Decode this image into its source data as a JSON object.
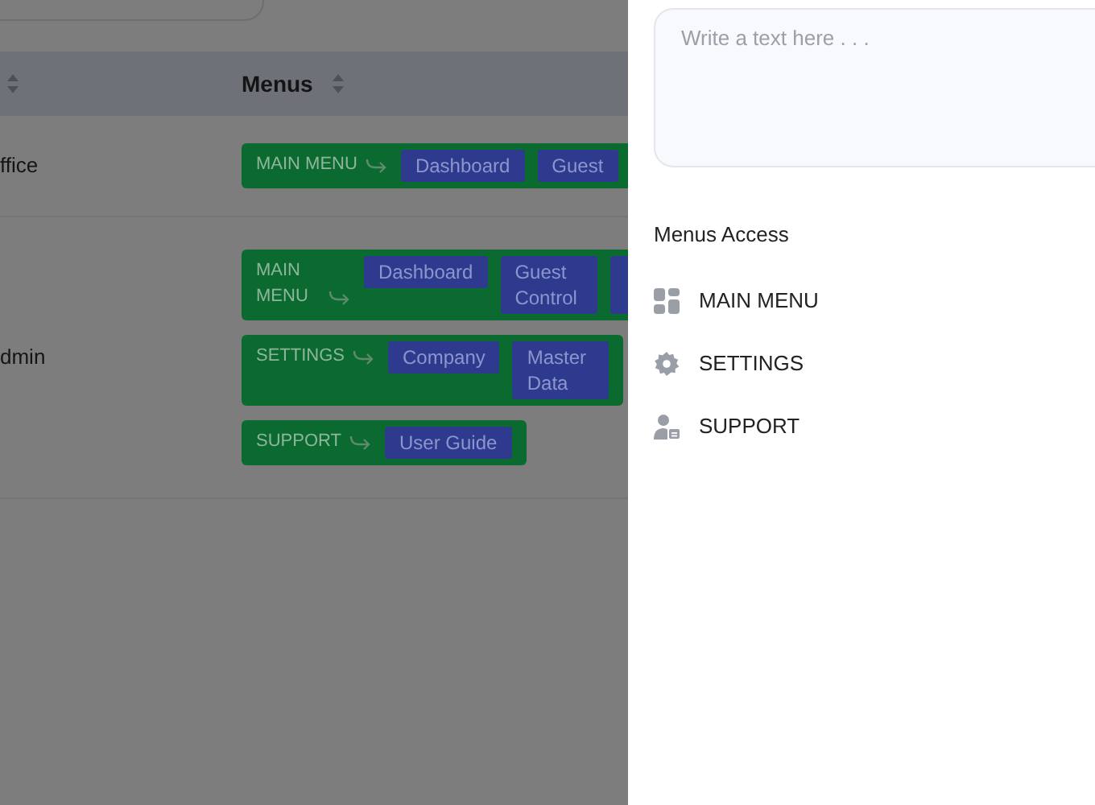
{
  "table": {
    "columns": [
      {
        "sortable": true
      },
      {
        "label": "Menus",
        "sortable": true
      }
    ],
    "rows": [
      {
        "column_1": "ffice",
        "menus": [
          {
            "group": "MAIN MENU",
            "items": [
              "Dashboard",
              "Guest"
            ],
            "clipped_item": false
          }
        ]
      },
      {
        "column_1": "dmin",
        "menus": [
          {
            "group": "MAIN MENU",
            "items": [
              "Dashboard",
              "Guest Control"
            ],
            "clipped_item": true
          },
          {
            "group": "SETTINGS",
            "items": [
              "Company",
              "Master Data"
            ],
            "clipped_item": false
          },
          {
            "group": "SUPPORT",
            "items": [
              "User Guide"
            ],
            "clipped_item": false
          }
        ]
      }
    ]
  },
  "drawer": {
    "text_field": {
      "placeholder": "Write a text here . . ."
    },
    "menus_access": {
      "title": "Menus Access",
      "items": [
        {
          "kind": "grid",
          "label": "MAIN MENU"
        },
        {
          "kind": "gear",
          "label": "SETTINGS"
        },
        {
          "kind": "user",
          "label": "SUPPORT"
        }
      ]
    }
  }
}
